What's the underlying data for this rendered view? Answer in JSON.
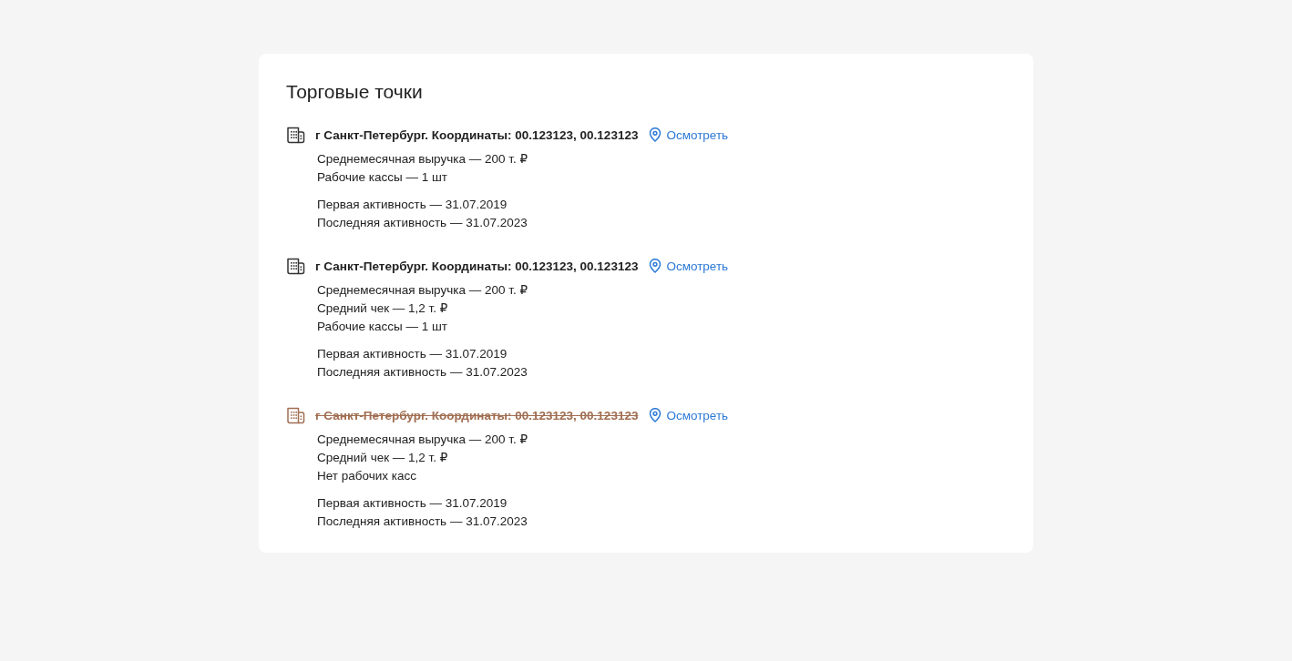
{
  "title": "Торговые точки",
  "points": [
    {
      "address": "г Санкт-Петербург. Координаты: 00.123123, 00.123123",
      "closed": false,
      "link": "Осмотреть",
      "stats": [
        "Среднемесячная выручка — 200 т. ₽",
        "Рабочие кассы — 1 шт"
      ],
      "activity": [
        "Первая активность — 31.07.2019",
        "Последняя активность — 31.07.2023"
      ]
    },
    {
      "address": "г Санкт-Петербург. Координаты: 00.123123, 00.123123",
      "closed": false,
      "link": "Осмотреть",
      "stats": [
        "Среднемесячная выручка — 200 т. ₽",
        "Средний чек — 1,2 т. ₽",
        "Рабочие кассы — 1 шт"
      ],
      "activity": [
        "Первая активность — 31.07.2019",
        "Последняя активность — 31.07.2023"
      ]
    },
    {
      "address": "г Санкт-Петербург. Координаты: 00.123123, 00.123123",
      "closed": true,
      "link": "Осмотреть",
      "stats": [
        "Среднемесячная выручка — 200 т. ₽",
        "Средний чек — 1,2 т. ₽",
        "Нет рабочих касс"
      ],
      "activity": [
        "Первая активность — 31.07.2019",
        "Последняя активность — 31.07.2023"
      ]
    }
  ]
}
